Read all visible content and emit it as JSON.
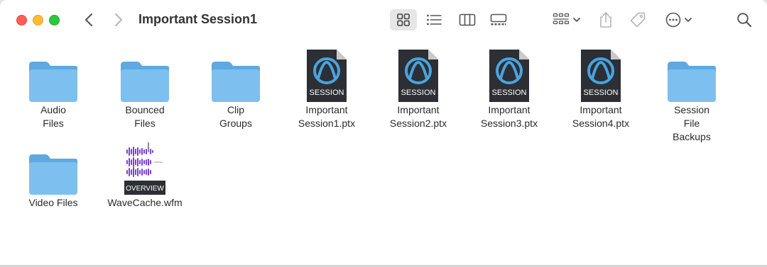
{
  "window": {
    "title": "Important Session1"
  },
  "toolbar": {
    "icons": [
      "chevron-left-icon",
      "chevron-right-icon",
      "grid-view-icon",
      "list-view-icon",
      "column-view-icon",
      "gallery-view-icon",
      "group-icon",
      "share-icon",
      "tag-icon",
      "more-icon",
      "search-icon"
    ]
  },
  "items": [
    {
      "name": "Audio Files",
      "type": "folder"
    },
    {
      "name": "Bounced Files",
      "type": "folder"
    },
    {
      "name": "Clip Groups",
      "type": "folder"
    },
    {
      "name": "Important Session1.ptx",
      "type": "session",
      "badge": "SESSION"
    },
    {
      "name": "Important Session2.ptx",
      "type": "session",
      "badge": "SESSION"
    },
    {
      "name": "Important Session3.ptx",
      "type": "session",
      "badge": "SESSION"
    },
    {
      "name": "Important Session4.ptx",
      "type": "session",
      "badge": "SESSION"
    },
    {
      "name": "Session File Backups",
      "type": "folder"
    },
    {
      "name": "Video Files",
      "type": "folder"
    },
    {
      "name": "WaveCache.wfm",
      "type": "wavecache",
      "badge": "OVERVIEW"
    }
  ],
  "colors": {
    "folder_body": "#7dc0ef",
    "folder_tab": "#5fa8e0",
    "session_doc": "#2c2f33",
    "session_logo": "#4aa3df",
    "waveform": "#7a3fd6"
  }
}
